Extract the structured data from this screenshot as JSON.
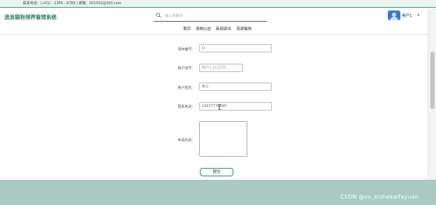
{
  "topbar": {
    "contact": "联系电话：(+01) - 2345 - 6789 | 邮箱：001002@163.com"
  },
  "header": {
    "site_title": "流浪猫狗领养管理系统",
    "search_placeholder": "输入关键词",
    "user_name": "用户1",
    "caret": "▾"
  },
  "nav": {
    "items": [
      "首页",
      "宠物公告",
      "新闻资讯",
      "流浪猫狗"
    ]
  },
  "form": {
    "fields": [
      {
        "label": "领养编号:",
        "value": "Q"
      },
      {
        "label": "用户账号:",
        "value": "用户1-112233"
      },
      {
        "label": "用户姓名:",
        "value": "张三"
      },
      {
        "label": "联系电话:",
        "value": "18977778899"
      },
      {
        "label": "申请内容:",
        "value": ""
      }
    ],
    "submit_label": "提交"
  },
  "watermark": "CSDN @vx_bishekaifayuan"
}
